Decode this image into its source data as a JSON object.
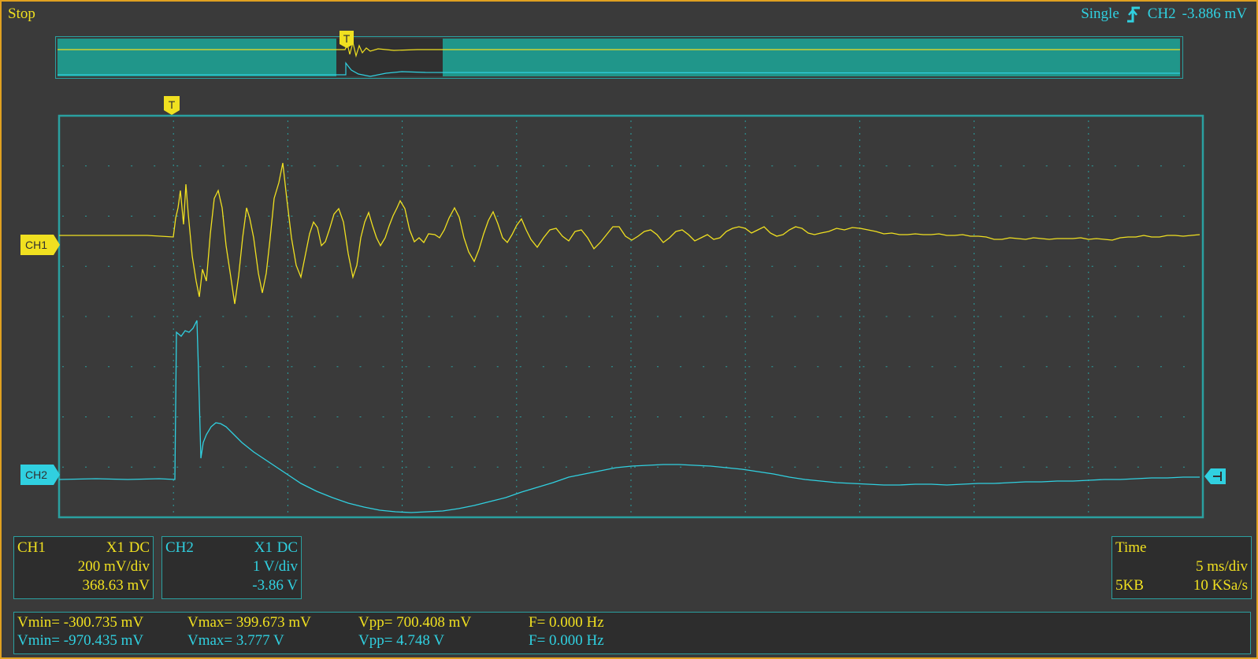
{
  "header": {
    "run_state": "Stop",
    "trigger_mode": "Single",
    "trigger_icon": "rising-edge-icon",
    "trigger_source": "CH2",
    "trigger_level": "-3.886 mV"
  },
  "markers": {
    "trigger": "T",
    "ch1": "CH1",
    "ch2": "CH2"
  },
  "colors": {
    "ch1": "#f0e020",
    "ch2": "#30d0e0",
    "grid": "#2aa0a0",
    "frame": "#e0a020"
  },
  "ch1": {
    "label": "CH1",
    "probe": "X1",
    "coupling": "DC",
    "scale": "200 mV/div",
    "offset": "368.63 mV"
  },
  "ch2": {
    "label": "CH2",
    "probe": "X1",
    "coupling": "DC",
    "scale": "1 V/div",
    "offset": "-3.86 V"
  },
  "timebase": {
    "label": "Time",
    "scale": "5 ms/div",
    "memory": "5KB",
    "rate": "10 KSa/s"
  },
  "measurements": {
    "ch1": {
      "vmin": "Vmin= -300.735 mV",
      "vmax": "Vmax= 399.673 mV",
      "vpp": "Vpp= 700.408 mV",
      "freq": "F= 0.000 Hz"
    },
    "ch2": {
      "vmin": "Vmin= -970.435 mV",
      "vmax": "Vmax= 3.777 V",
      "vpp": "Vpp= 4.748 V",
      "freq": "F= 0.000 Hz"
    }
  }
}
